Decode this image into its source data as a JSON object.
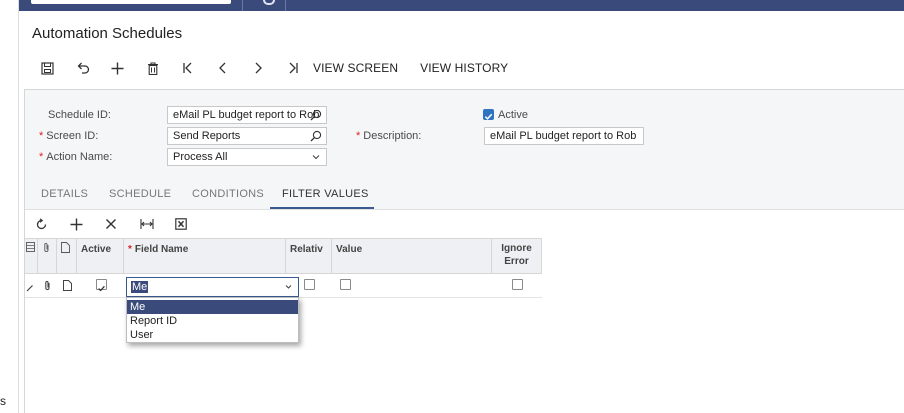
{
  "left_nav": {
    "fragment": "s"
  },
  "page": {
    "title": "Automation Schedules"
  },
  "toolbar": {
    "icons": [
      "save-icon",
      "undo-icon",
      "add-icon",
      "delete-icon",
      "first-icon",
      "prev-icon",
      "next-icon",
      "last-icon"
    ],
    "view_screen": "VIEW SCREEN",
    "view_history": "VIEW HISTORY"
  },
  "form": {
    "schedule_id_label": "Schedule ID:",
    "schedule_id_value": "eMail PL budget report to Rob",
    "screen_id_label": "Screen ID:",
    "screen_id_value": "Send Reports",
    "action_name_label": "Action Name:",
    "action_name_value": "Process All",
    "active_label": "Active",
    "active_checked": true,
    "description_label": "Description:",
    "description_value": "eMail PL budget report to Rob",
    "required_mark": "*"
  },
  "tabs": [
    {
      "label": "DETAILS"
    },
    {
      "label": "SCHEDULE"
    },
    {
      "label": "CONDITIONS"
    },
    {
      "label": "FILTER VALUES",
      "active": true
    }
  ],
  "grid_toolbar": {
    "icons": [
      "refresh-icon",
      "add-row-icon",
      "delete-row-icon",
      "fit-columns-icon",
      "export-excel-icon"
    ]
  },
  "grid": {
    "headers": {
      "active": "Active",
      "field_name": "Field Name",
      "relative": "Relativ",
      "value": "Value",
      "ignore_error": "Ignore Error",
      "ignore_error_line1": "Ignore",
      "ignore_error_line2": "Error"
    },
    "row": {
      "active": true,
      "field_name": "Me",
      "relative": false,
      "ignore_error": false
    }
  },
  "dropdown": {
    "options": [
      "Me",
      "Report ID",
      "User"
    ],
    "selected": "Me"
  },
  "colors": {
    "brand": "#3a4a7a",
    "accent": "#2f74c0",
    "required": "#d22"
  }
}
